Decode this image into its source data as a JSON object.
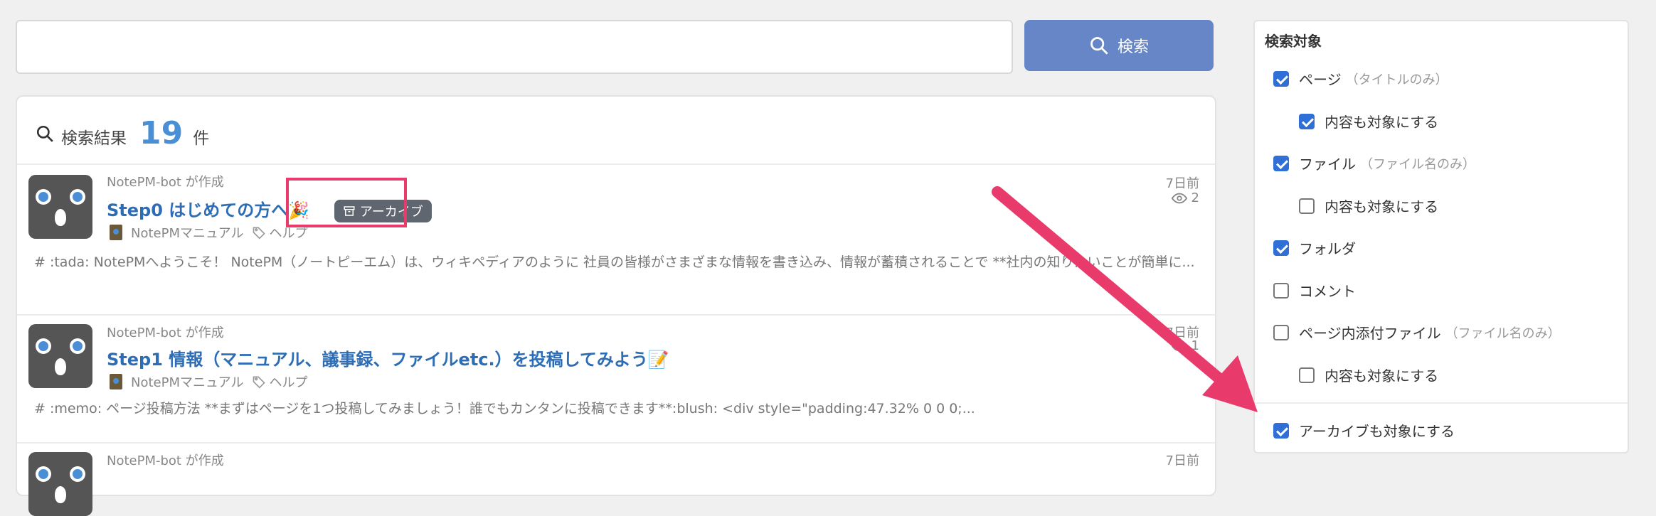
{
  "search": {
    "value": "",
    "placeholder": "",
    "button_label": "検索"
  },
  "results": {
    "label": "検索結果",
    "count": "19",
    "unit": "件",
    "items": [
      {
        "author": "NotePM-bot が作成",
        "title": "Step0 はじめての方へ🎉",
        "archive_badge": "アーカイブ",
        "folder": "NotePMマニュアル",
        "tag": "ヘルプ",
        "snippet": "# :tada: NotePMへようこそ！ NotePM（ノートピーエム）は、ウィキペディアのように 社員の皆様がさまざまな情報を書き込み、情報が蓄積されることで **社内の知りたいことが簡単に...",
        "date": "7日前",
        "views": "2"
      },
      {
        "author": "NotePM-bot が作成",
        "title": "Step1 情報（マニュアル、議事録、ファイルetc.）を投稿してみよう📝",
        "folder": "NotePMマニュアル",
        "tag": "ヘルプ",
        "snippet": "# :memo: ページ投稿方法 **まずはページを1つ投稿してみましょう！誰でもカンタンに投稿できます**:blush: <div style=\"padding:47.32% 0 0 0;...",
        "date": "7日前",
        "views": "1"
      },
      {
        "author": "NotePM-bot が作成",
        "date": "7日前"
      }
    ]
  },
  "filter": {
    "title": "検索対象",
    "options": [
      {
        "label": "ページ",
        "note": "（タイトルのみ）",
        "checked": true
      },
      {
        "label": "内容も対象にする",
        "checked": true
      },
      {
        "label": "ファイル",
        "note": "（ファイル名のみ）",
        "checked": true
      },
      {
        "label": "内容も対象にする",
        "checked": false
      },
      {
        "label": "フォルダ",
        "checked": true
      },
      {
        "label": "コメント",
        "checked": false
      },
      {
        "label": "ページ内添付ファイル",
        "note": "（ファイル名のみ）",
        "checked": false
      },
      {
        "label": "内容も対象にする",
        "checked": false
      },
      {
        "label": "アーカイブも対象にする",
        "checked": true
      }
    ]
  },
  "colors": {
    "accent": "#6686c8",
    "link": "#2d6db6",
    "count": "#4a8fd6",
    "highlight": "#e93a6c",
    "checkbox": "#2f6fd6"
  }
}
